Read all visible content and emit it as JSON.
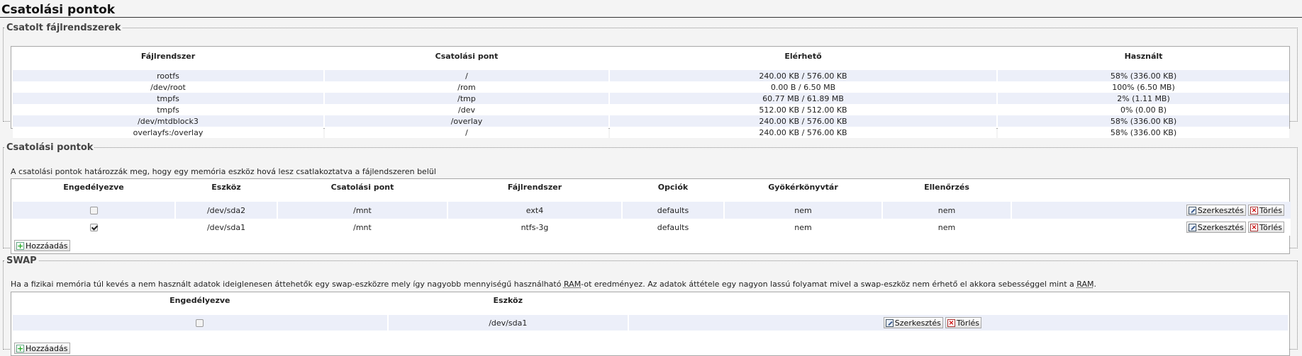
{
  "page_title": "Csatolási pontok",
  "mounted": {
    "legend": "Csatolt fájlrendszerek",
    "headers": [
      "Fájlrendszer",
      "Csatolási pont",
      "Elérhető",
      "Használt"
    ],
    "rows": [
      [
        "rootfs",
        "/",
        "240.00 KB / 576.00 KB",
        "58% (336.00 KB)"
      ],
      [
        "/dev/root",
        "/rom",
        "0.00 B / 6.50 MB",
        "100% (6.50 MB)"
      ],
      [
        "tmpfs",
        "/tmp",
        "60.77 MB / 61.89 MB",
        "2% (1.11 MB)"
      ],
      [
        "tmpfs",
        "/dev",
        "512.00 KB / 512.00 KB",
        "0% (0.00 B)"
      ],
      [
        "/dev/mtdblock3",
        "/overlay",
        "240.00 KB / 576.00 KB",
        "58% (336.00 KB)"
      ],
      [
        "overlayfs:/overlay",
        "/",
        "240.00 KB / 576.00 KB",
        "58% (336.00 KB)"
      ]
    ]
  },
  "mountpoints": {
    "legend": "Csatolási pontok",
    "description": "A csatolási pontok határozzák meg, hogy egy memória eszköz hová lesz csatlakoztatva a fájlendszeren belül",
    "headers": [
      "Engedélyezve",
      "Eszköz",
      "Csatolási pont",
      "Fájlrendszer",
      "Opciók",
      "Gyökérkönyvtár",
      "Ellenőrzés"
    ],
    "rows": [
      {
        "enabled": false,
        "device": "/dev/sda2",
        "mount": "/mnt",
        "fs": "ext4",
        "options": "defaults",
        "root": "nem",
        "check": "nem"
      },
      {
        "enabled": true,
        "device": "/dev/sda1",
        "mount": "/mnt",
        "fs": "ntfs-3g",
        "options": "defaults",
        "root": "nem",
        "check": "nem"
      }
    ],
    "edit_label": "Szerkesztés",
    "delete_label": "Törlés",
    "add_label": "Hozzáadás"
  },
  "swap": {
    "legend": "SWAP",
    "desc_1": "Ha a fizikai memória túl kevés a nem használt adatok ideiglenesen áttehetők egy swap-eszközre mely így nagyobb mennyiségű használható ",
    "desc_ram_1": "RAM",
    "desc_2": "-ot eredményez. Az adatok áttétele egy nagyon lassú folyamat mivel a swap-eszköz nem érhető el akkora sebességgel mint a ",
    "desc_ram_2": "RAM",
    "desc_3": ".",
    "headers": [
      "Engedélyezve",
      "Eszköz"
    ],
    "rows": [
      {
        "enabled": false,
        "device": "/dev/sda1"
      }
    ],
    "edit_label": "Szerkesztés",
    "delete_label": "Törlés",
    "add_label": "Hozzáadás"
  },
  "icons": {
    "edit": "edit-icon",
    "delete": "delete-icon",
    "add": "add-icon"
  },
  "colors": {
    "odd_row": "#eceff9",
    "border": "#a8a8a8"
  }
}
